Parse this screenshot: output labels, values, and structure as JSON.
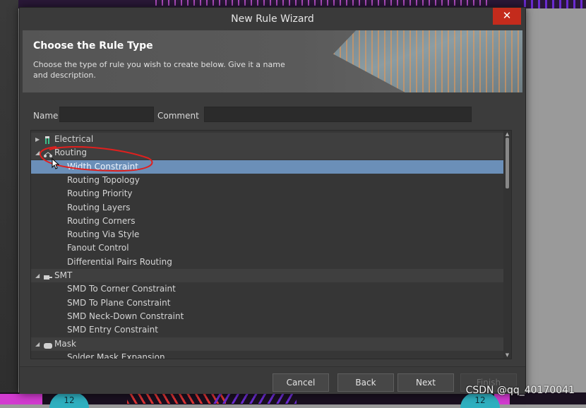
{
  "window": {
    "title": "New Rule Wizard",
    "close_glyph": "✕"
  },
  "banner": {
    "heading": "Choose the Rule Type",
    "description": "Choose the type of rule you wish to create below. Give it a name and description."
  },
  "form": {
    "name_label": "Name",
    "name_value": "",
    "comment_label": "Comment",
    "comment_value": ""
  },
  "tree": {
    "rows": [
      {
        "type": "category",
        "label": "Electrical",
        "expanded": false,
        "icon": "electrical-icon"
      },
      {
        "type": "category",
        "label": "Routing",
        "expanded": true,
        "icon": "routing-icon"
      },
      {
        "type": "item",
        "label": "Width Constraint",
        "selected": true
      },
      {
        "type": "item",
        "label": "Routing Topology"
      },
      {
        "type": "item",
        "label": "Routing Priority"
      },
      {
        "type": "item",
        "label": "Routing Layers"
      },
      {
        "type": "item",
        "label": "Routing Corners"
      },
      {
        "type": "item",
        "label": "Routing Via Style"
      },
      {
        "type": "item",
        "label": "Fanout Control"
      },
      {
        "type": "item",
        "label": "Differential Pairs Routing"
      },
      {
        "type": "category",
        "label": "SMT",
        "expanded": true,
        "icon": "smt-icon"
      },
      {
        "type": "item",
        "label": "SMD To Corner Constraint"
      },
      {
        "type": "item",
        "label": "SMD To Plane Constraint"
      },
      {
        "type": "item",
        "label": "SMD Neck-Down Constraint"
      },
      {
        "type": "item",
        "label": "SMD Entry Constraint"
      },
      {
        "type": "category",
        "label": "Mask",
        "expanded": true,
        "icon": "mask-icon"
      },
      {
        "type": "item",
        "label": "Solder Mask Expansion"
      }
    ]
  },
  "buttons": {
    "cancel": "Cancel",
    "back": "Back",
    "next": "Next",
    "finish": "Finish"
  },
  "background": {
    "pad_left": "12",
    "pad_right": "12"
  },
  "watermark": "CSDN @qq_40170041",
  "colors": {
    "selection": "#6b8fb8",
    "annotation": "#e0201e",
    "close_button": "#c42b1c"
  }
}
